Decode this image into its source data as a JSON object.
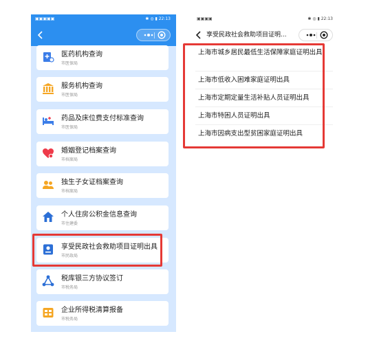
{
  "left_phone": {
    "status": {
      "left": "▣▣▣▣▣",
      "right": "✱ ◎ ▮ 22:13"
    },
    "services": [
      {
        "title": "医药机构查询",
        "dept": "市医保局",
        "icon": "hospital-icon",
        "color": "#3b7de8"
      },
      {
        "title": "服务机构查询",
        "dept": "市医保局",
        "icon": "institution-icon",
        "color": "#f5a623"
      },
      {
        "title": "药品及床位费支付标准查询",
        "dept": "市医保局",
        "icon": "bed-icon",
        "color": "#3b7de8"
      },
      {
        "title": "婚姻登记档案查询",
        "dept": "市档案局",
        "icon": "heart-icon",
        "color": "#ee3b4a"
      },
      {
        "title": "独生子女证档案查询",
        "dept": "市档案局",
        "icon": "family-icon",
        "color": "#f5a623"
      },
      {
        "title": "个人住房公积金信息查询",
        "dept": "市住建委",
        "icon": "house-icon",
        "color": "#2c6fd6"
      },
      {
        "title": "享受民政社会救助项目证明出具",
        "dept": "市民政局",
        "icon": "certificate-icon",
        "color": "#2c6fd6"
      },
      {
        "title": "税库银三方协议签订",
        "dept": "市税务局",
        "icon": "network-icon",
        "color": "#2c6fd6"
      },
      {
        "title": "企业所得税清算报备",
        "dept": "市税务局",
        "icon": "tax-report-icon",
        "color": "#f5a623"
      }
    ]
  },
  "right_phone": {
    "status": {
      "left": "▣▣▣▣",
      "right": "✱ ◎ ▮ 22:13"
    },
    "title": "享受民政社会救助项目证明...",
    "items": [
      "上海市城乡居民最低生活保障家庭证明出具",
      "上海市低收入困难家庭证明出具",
      "上海市定期定量生活补贴人员证明出具",
      "上海市特困人员证明出具",
      "上海市因病支出型贫困家庭证明出具"
    ]
  },
  "colors": {
    "header_blue": "#2c8ff0",
    "list_bg": "#d6e8ff",
    "highlight": "#e53935"
  }
}
